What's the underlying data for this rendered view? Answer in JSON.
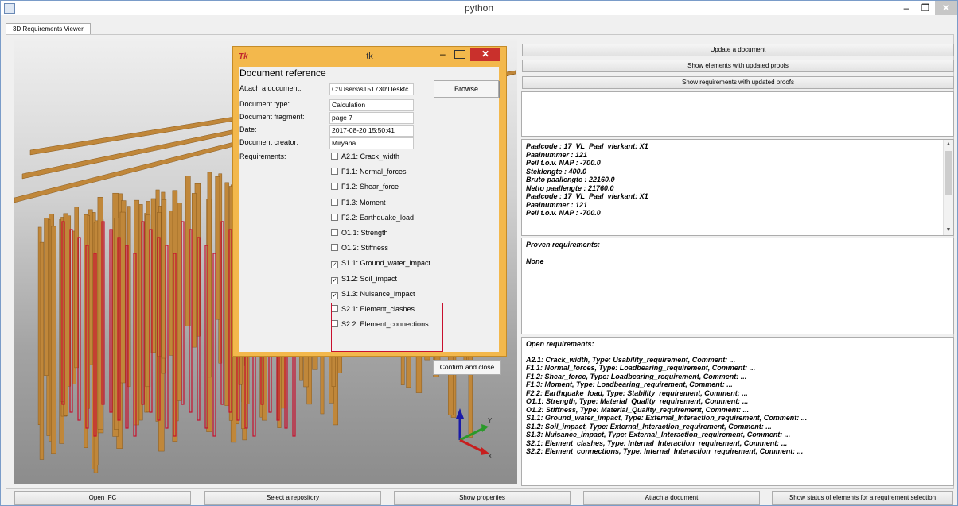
{
  "window": {
    "title": "python",
    "min": "–",
    "max": "❐",
    "close": "✕"
  },
  "tab": {
    "label": "3D Requirements Viewer"
  },
  "right_buttons": [
    "Update a document",
    "Show elements with updated proofs",
    "Show requirements with updated proofs"
  ],
  "info_panel": {
    "lines": [
      "Paalcode : 17_VL_Paal_vierkant: X1",
      "Paalnummer : 121",
      "Peil t.o.v. NAP : -700.0",
      "Steklengte : 400.0",
      "Bruto paallengte : 22160.0",
      "Netto paallengte : 21760.0",
      "Paalcode : 17_VL_Paal_vierkant: X1",
      "Paalnummer : 121",
      "Peil t.o.v. NAP : -700.0"
    ]
  },
  "proven": {
    "title": "Proven requirements:",
    "value": "None"
  },
  "open": {
    "title": "Open requirements:",
    "lines": [
      "A2.1: Crack_width, Type: Usability_requirement, Comment: ...",
      "F1.1: Normal_forces, Type: Loadbearing_requirement, Comment: ...",
      "F1.2: Shear_force, Type: Loadbearing_requirement, Comment: ...",
      "F1.3: Moment, Type: Loadbearing_requirement, Comment: ...",
      "F2.2: Earthquake_load, Type: Stability_requirement, Comment: ...",
      "O1.1: Strength, Type: Material_Quality_requirement, Comment: ...",
      "O1.2: Stiffness, Type: Material_Quality_requirement, Comment: ...",
      "S1.1: Ground_water_impact, Type: External_Interaction_requirement, Comment: ...",
      "S1.2: Soil_impact, Type: External_Interaction_requirement, Comment: ...",
      "S1.3: Nuisance_impact, Type: External_Interaction_requirement, Comment: ...",
      "S2.1: Element_clashes, Type: Internal_Interaction_requirement, Comment: ...",
      "S2.2: Element_connections, Type: Internal_Interaction_requirement, Comment: ..."
    ]
  },
  "bottom_buttons": [
    "Open IFC",
    "Select a repository",
    "Show properties",
    "Attach a document",
    "Show status of elements for a requirement selection"
  ],
  "axes": {
    "y": "Y",
    "x": "X"
  },
  "dialog": {
    "title": "tk",
    "tk_icon": "Tk",
    "heading": "Document reference",
    "labels": {
      "attach": "Attach a document:",
      "type": "Document type:",
      "fragment": "Document fragment:",
      "date": "Date:",
      "creator": "Document creator:",
      "requirements": "Requirements:"
    },
    "values": {
      "attach": "C:\\Users\\s151730\\Desktc",
      "type": "Calculation",
      "fragment": "page 7",
      "date": "2017-08-20 15:50:41",
      "creator": "Miryana"
    },
    "browse": "Browse",
    "confirm": "Confirm and close",
    "requirements": [
      {
        "label": "A2.1: Crack_width",
        "checked": false
      },
      {
        "label": "F1.1: Normal_forces",
        "checked": false
      },
      {
        "label": "F1.2: Shear_force",
        "checked": false
      },
      {
        "label": "F1.3: Moment",
        "checked": false
      },
      {
        "label": "F2.2: Earthquake_load",
        "checked": false
      },
      {
        "label": "O1.1: Strength",
        "checked": false
      },
      {
        "label": "O1.2: Stiffness",
        "checked": false
      },
      {
        "label": "S1.1: Ground_water_impact",
        "checked": true
      },
      {
        "label": "S1.2: Soil_impact",
        "checked": true
      },
      {
        "label": "S1.3: Nuisance_impact",
        "checked": true
      },
      {
        "label": "S2.1: Element_clashes",
        "checked": false
      },
      {
        "label": "S2.2: Element_connections",
        "checked": false
      }
    ]
  },
  "colors": {
    "pile": "#c0873a",
    "highlight": "#c8102e",
    "dialog_frame": "#f3b84c"
  }
}
